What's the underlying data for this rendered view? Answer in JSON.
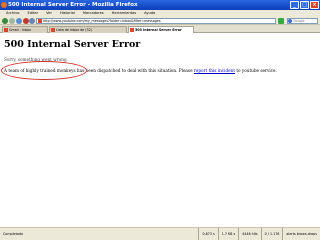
{
  "window": {
    "title": "500 Internal Server Error - Mozilla Firefox"
  },
  "menu": [
    "Archivo",
    "Editar",
    "Ver",
    "Historial",
    "Marcadores",
    "Herramientas",
    "Ayuda"
  ],
  "nav": {
    "url": "http://www.youtube.com/my_messages?folder=inbox&filter=messages",
    "search_placeholder": "Google"
  },
  "tabs": [
    {
      "label": "Gmail - Inbox",
      "active": false
    },
    {
      "label": "Lista de Inbox de (32)",
      "active": false
    },
    {
      "label": "500 Internal Server Error",
      "active": true
    }
  ],
  "page": {
    "title": "500 Internal Server Error",
    "sorry": "Sorry, something went wrong.",
    "message_before": "A team of highly trained monkeys has been dispatched to deal with this situation. Please ",
    "message_link": "report this incident",
    "message_after": " to youtube service."
  },
  "status": {
    "left": "Completado",
    "segments": [
      "0.673 s",
      "1.7 KB s",
      "4446 hits",
      "0 / 1.176",
      "alerts brows-drops"
    ]
  }
}
